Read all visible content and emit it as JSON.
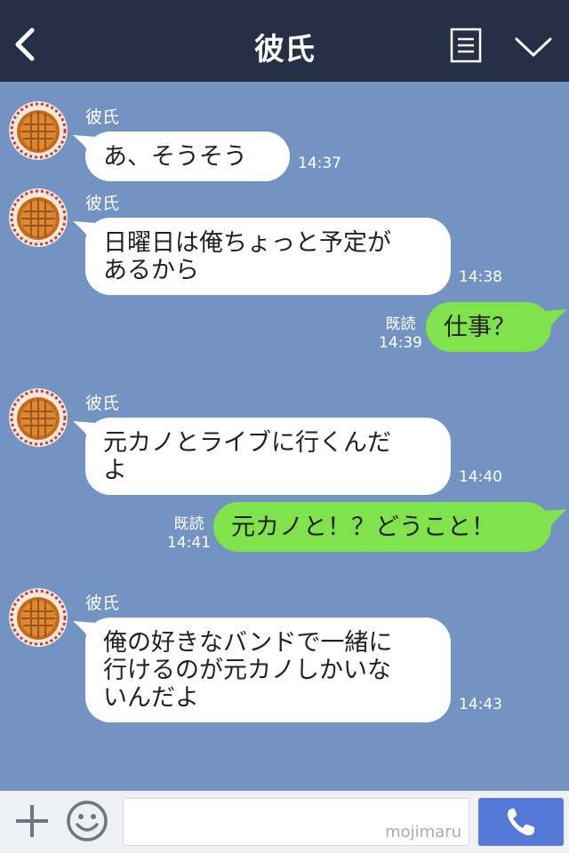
{
  "header": {
    "title": "彼氏"
  },
  "messages": [
    {
      "side": "in",
      "sender": "彼氏",
      "lines": [
        "あ、そうそう"
      ],
      "time": "14:37"
    },
    {
      "side": "in",
      "sender": "彼氏",
      "lines": [
        "日曜日は俺ちょっと予定が",
        "あるから"
      ],
      "time": "14:38"
    },
    {
      "side": "out",
      "lines": [
        "仕事？"
      ],
      "read": "既読",
      "time": "14:39"
    },
    {
      "side": "in",
      "sender": "彼氏",
      "lines": [
        "元カノとライブに行くんだ",
        "よ"
      ],
      "time": "14:40"
    },
    {
      "side": "out",
      "lines": [
        "元カノと！？どうこと！"
      ],
      "read": "既読",
      "time": "14:41"
    },
    {
      "side": "in",
      "sender": "彼氏",
      "lines": [
        "俺の好きなバンドで一緒に",
        "行けるのが元カノしかいな",
        "いんだよ"
      ],
      "time": "14:43"
    }
  ],
  "footer": {
    "watermark": "mojimaru"
  },
  "colors": {
    "header": "#252f45",
    "chat_bg": "#7393c3",
    "outgoing": "#80e34b",
    "incoming": "#ffffff",
    "call_button": "#5579d6"
  },
  "icons": [
    "back-icon",
    "menu-icon",
    "chevron-down-icon",
    "plus-icon",
    "smile-icon",
    "phone-icon",
    "avatar-pie-icon"
  ]
}
